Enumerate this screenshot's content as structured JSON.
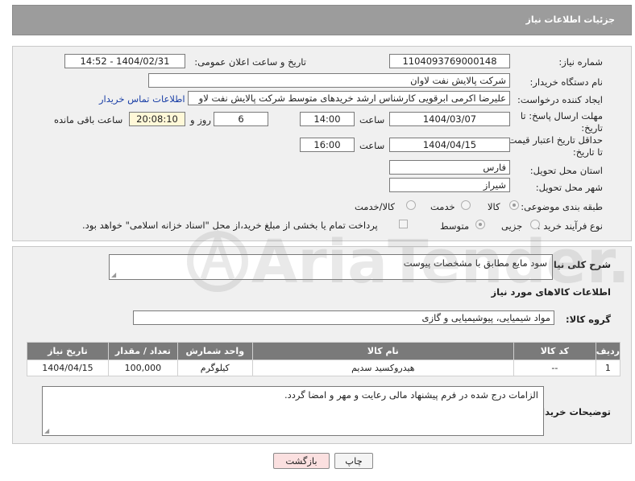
{
  "header": {
    "title": "جزئیات اطلاعات نیاز"
  },
  "form": {
    "need_number_label": "شماره نیاز:",
    "need_number": "1104093769000148",
    "announce_label": "تاریخ و ساعت اعلان عمومی:",
    "announce_value": "1404/02/31 - 14:52",
    "buyer_label": "نام دستگاه خریدار:",
    "buyer_value": "شرکت پالایش نفت لاوان",
    "creator_label": "ایجاد کننده درخواست:",
    "creator_value": "علیرضا اکرمی ابرقویی کارشناس ارشد خریدهای متوسط شرکت پالایش نفت لاو",
    "contact_link": "اطلاعات تماس خریدار",
    "deadline_label": "مهلت ارسال پاسخ: تا تاریخ:",
    "deadline_date": "1404/03/07",
    "time_label": "ساعت",
    "deadline_time": "14:00",
    "days_value": "6",
    "days_label": "روز و",
    "remaining_time": "20:08:10",
    "remaining_label": "ساعت باقی مانده",
    "price_valid_label": "حداقل تاریخ اعتبار قیمت: تا تاریخ:",
    "price_valid_date": "1404/04/15",
    "price_valid_time": "16:00",
    "province_label": "استان محل تحویل:",
    "province_value": "فارس",
    "city_label": "شهر محل تحویل:",
    "city_value": "شیراز",
    "category_label": "طبقه بندی موضوعی:",
    "category_options": [
      "کالا",
      "خدمت",
      "کالا/خدمت"
    ],
    "category_selected": "کالا",
    "process_label": "نوع فرآیند خرید :",
    "process_options": [
      "جزیی",
      "متوسط"
    ],
    "process_selected": "متوسط",
    "payment_note": "پرداخت تمام یا بخشی از مبلغ خرید،از محل \"اسناد خزانه اسلامی\" خواهد بود."
  },
  "description": {
    "label": "شرح کلی نیاز:",
    "value": "سود مایع مطابق با مشخصات پیوست"
  },
  "goods": {
    "section_title": "اطلاعات کالاهای مورد نیاز",
    "group_label": "گروه کالا:",
    "group_value": "مواد شیمیایی، پیوشیمیایی و  گازی",
    "columns": [
      "ردیف",
      "کد کالا",
      "نام کالا",
      "واحد شمارش",
      "تعداد / مقدار",
      "تاریخ نیاز"
    ],
    "rows": [
      {
        "index": "1",
        "code": "--",
        "name": "هیدروکسید سدیم",
        "unit": "کیلوگرم",
        "qty": "100,000",
        "date": "1404/04/15"
      }
    ]
  },
  "buyer_notes": {
    "label": "توضیحات خریدار:",
    "value": "الزامات درج شده در فرم پیشنهاد مالی رعایت و مهر و امضا گردد."
  },
  "buttons": {
    "print": "چاپ",
    "back": "بازگشت"
  },
  "watermark": "AriaTender.net"
}
